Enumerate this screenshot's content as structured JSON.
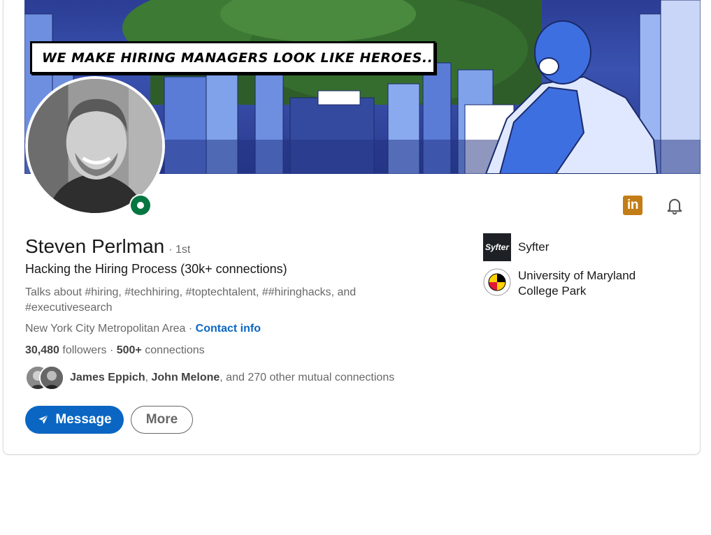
{
  "banner": {
    "tagline": "WE MAKE HIRING MANAGERS LOOK LIKE HEROES..."
  },
  "profile": {
    "name": "Steven Perlman",
    "degree": "· 1st",
    "headline": "Hacking the Hiring Process (30k+ connections)",
    "talks_about": "Talks about #hiring, #techhiring, #toptechtalent, ##hiringhacks, and #executivesearch",
    "location": "New York City Metropolitan Area",
    "location_separator": " · ",
    "contact_label": "Contact info",
    "followers_count": "30,480",
    "followers_label": " followers",
    "stats_separator": "  · ",
    "connections_count": "500+",
    "connections_label": " connections",
    "online": true
  },
  "mutual": {
    "name1": "James Eppich",
    "sep": ", ",
    "name2": "John Melone",
    "rest": ", and 270 other mutual connections"
  },
  "actions": {
    "message_label": "Message",
    "more_label": "More"
  },
  "side": {
    "company_logo_text": "Syfter",
    "company_name": "Syfter",
    "school_name": "University of Maryland College Park"
  },
  "icons": {
    "linkedin_badge": "in",
    "notification": "bell-icon"
  },
  "colors": {
    "primary": "#0a66c2",
    "online": "#057642",
    "linkedin_badge": "#c37d16"
  }
}
